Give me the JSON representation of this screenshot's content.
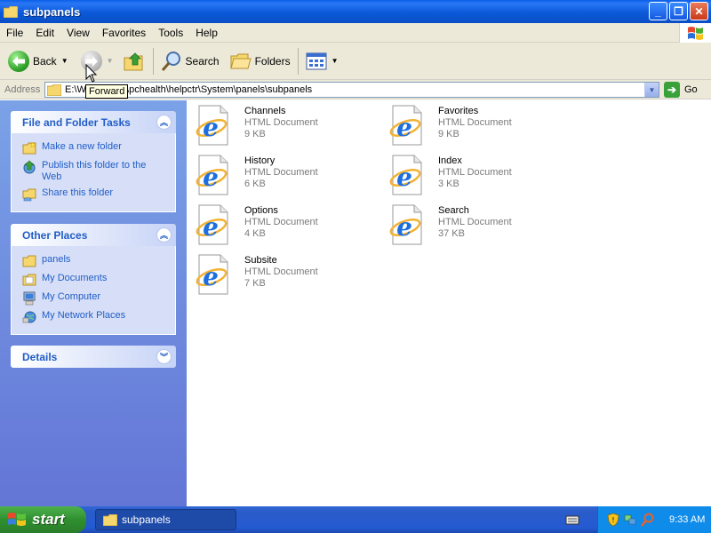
{
  "window": {
    "title": "subpanels"
  },
  "menu": [
    "File",
    "Edit",
    "View",
    "Favorites",
    "Tools",
    "Help"
  ],
  "toolbar": {
    "back_label": "Back",
    "search_label": "Search",
    "folders_label": "Folders"
  },
  "tooltip": "Forward",
  "address": {
    "label": "Address",
    "path": "E:\\WINDOWS\\pchealth\\helpctr\\System\\panels\\subpanels",
    "go_label": "Go"
  },
  "tasks_panel": {
    "title": "File and Folder Tasks",
    "items": [
      "Make a new folder",
      "Publish this folder to the Web",
      "Share this folder"
    ]
  },
  "places_panel": {
    "title": "Other Places",
    "items": [
      "panels",
      "My Documents",
      "My Computer",
      "My Network Places"
    ]
  },
  "details_panel": {
    "title": "Details"
  },
  "files": [
    {
      "name": "Channels",
      "type": "HTML Document",
      "size": "9 KB"
    },
    {
      "name": "Favorites",
      "type": "HTML Document",
      "size": "9 KB"
    },
    {
      "name": "History",
      "type": "HTML Document",
      "size": "6 KB"
    },
    {
      "name": "Index",
      "type": "HTML Document",
      "size": "3 KB"
    },
    {
      "name": "Options",
      "type": "HTML Document",
      "size": "4 KB"
    },
    {
      "name": "Search",
      "type": "HTML Document",
      "size": "37 KB"
    },
    {
      "name": "Subsite",
      "type": "HTML Document",
      "size": "7 KB"
    }
  ],
  "taskbar": {
    "start_label": "start",
    "window_button": "subpanels",
    "clock": "9:33 AM"
  },
  "colors": {
    "title_blue": "#0b59d9",
    "task_link": "#215dc6",
    "taskbar_blue": "#245ad2",
    "start_green": "#2f8f2f",
    "tray_blue": "#0f8be9"
  }
}
